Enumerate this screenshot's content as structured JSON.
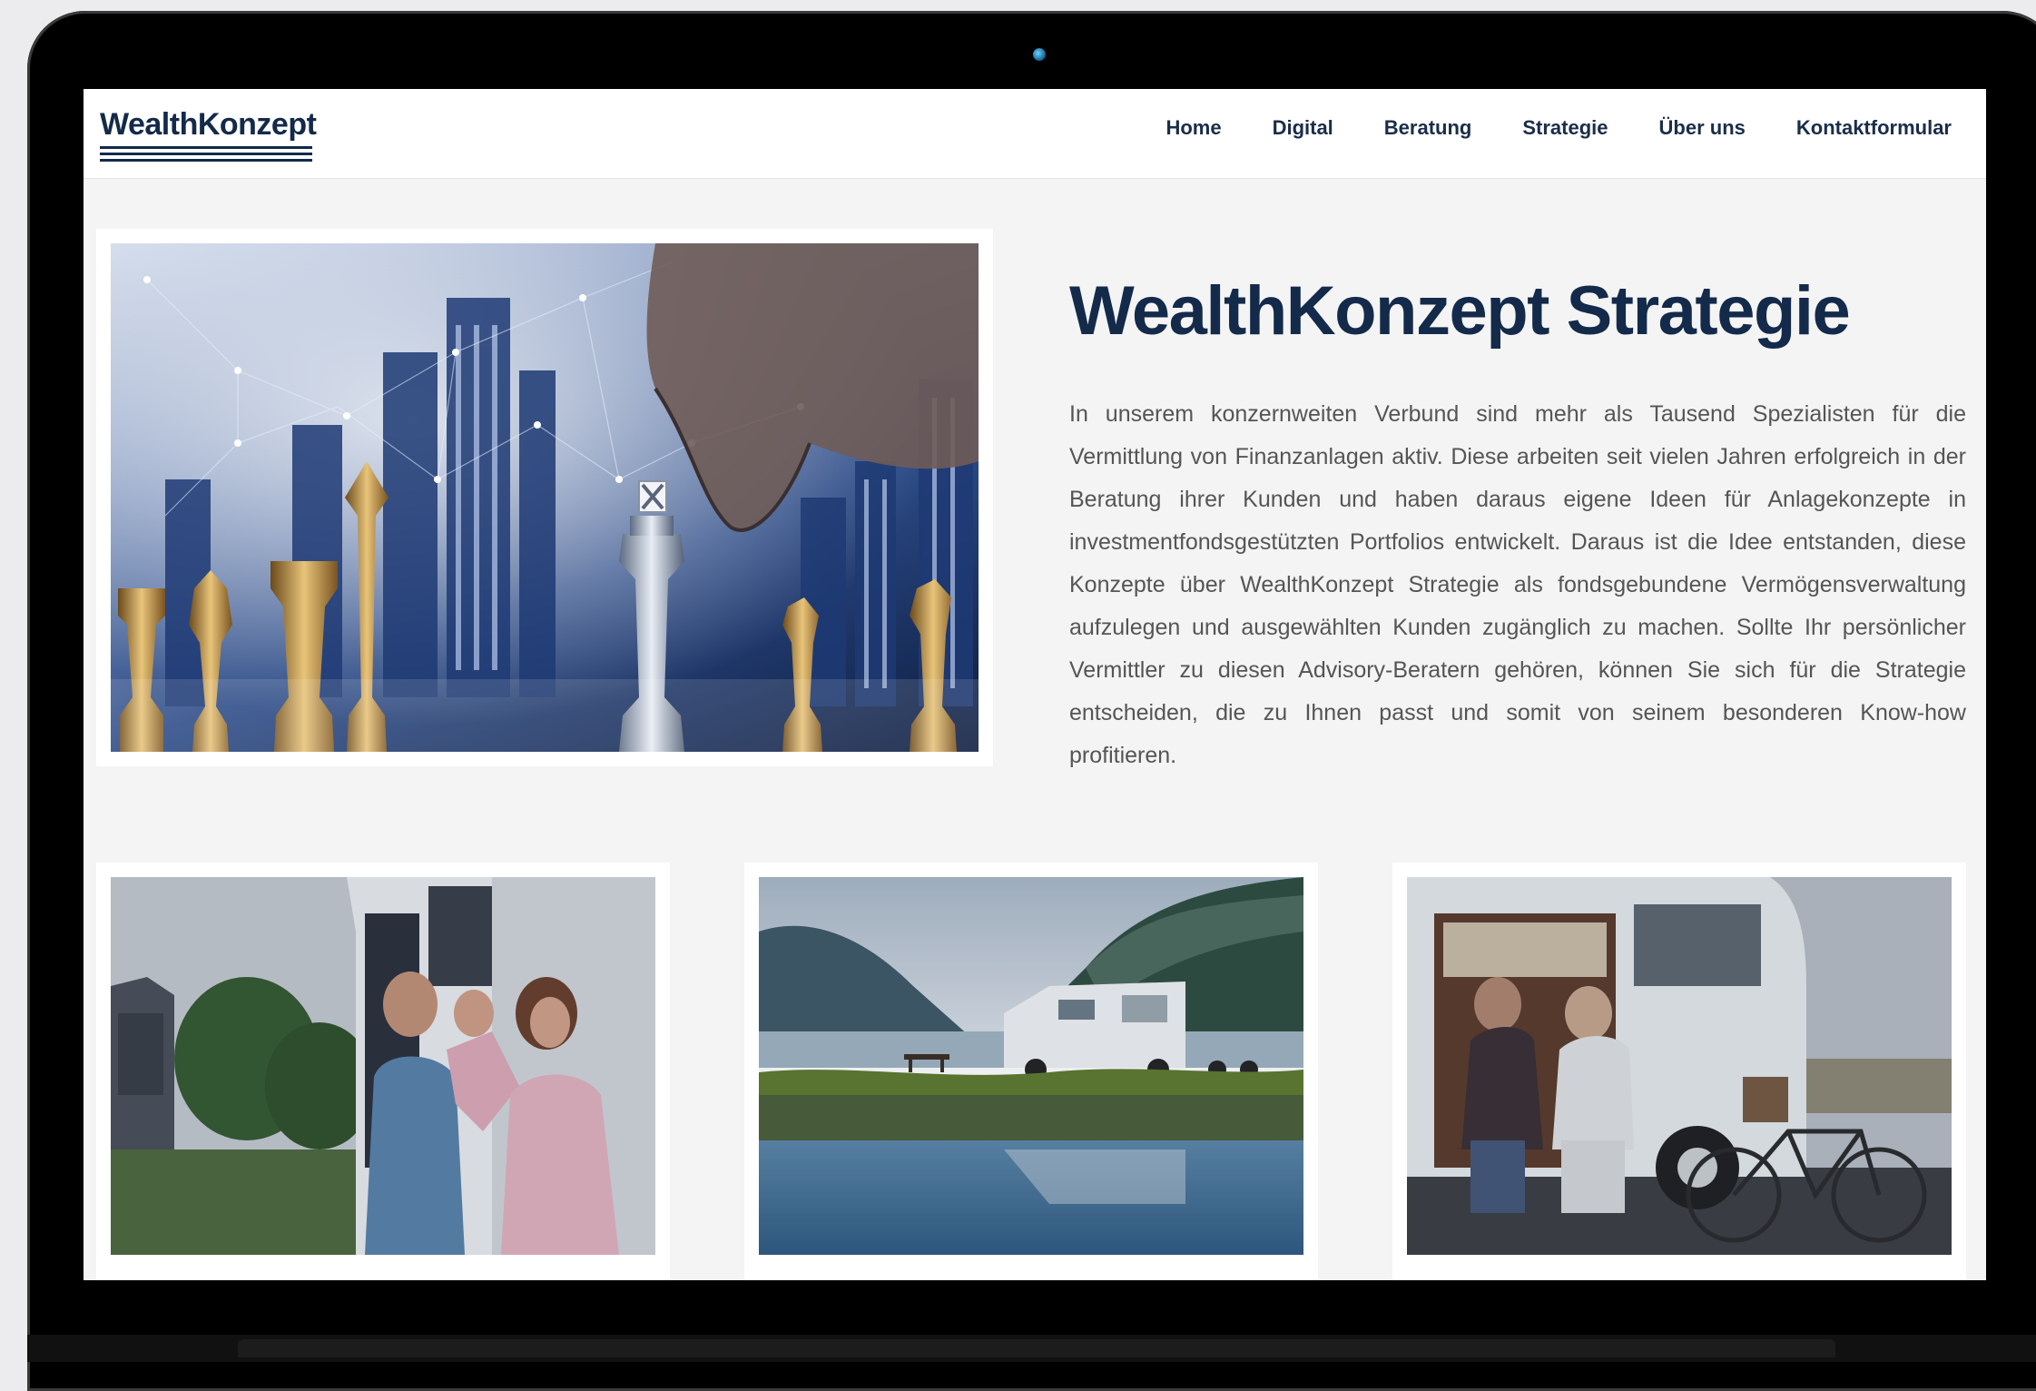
{
  "brand": {
    "logo": "WealthKonzept"
  },
  "nav": {
    "items": [
      "Home",
      "Digital",
      "Beratung",
      "Strategie",
      "Über uns",
      "Kontaktformular"
    ]
  },
  "main": {
    "title": "WealthKonzept Strategie",
    "paragraph": "In unserem konzernweiten Verbund sind mehr als Tausend Spezialisten für die Vermittlung von Finanzanlagen aktiv. Diese arbeiten seit vielen Jahren erfolgreich in der Beratung ihrer Kunden und haben daraus eigene Ideen für Anlagekonzepte in investmentfondsgestützten Portfolios entwickelt. Daraus ist die Idee entstanden, diese Konzepte über WealthKonzept Strategie als fondsgebundene Vermögensverwaltung aufzulegen und ausgewählten Kunden zugänglich zu machen. Sollte Ihr persönlicher Vermittler zu diesen Advisory-Beratern gehören, können Sie sich für die Strategie entscheiden, die zu Ihnen passt und somit von seinem besonderen Know-how profitieren."
  },
  "colors": {
    "brand": "#142a4a",
    "text": "#555555",
    "page_bg": "#f4f4f4"
  }
}
